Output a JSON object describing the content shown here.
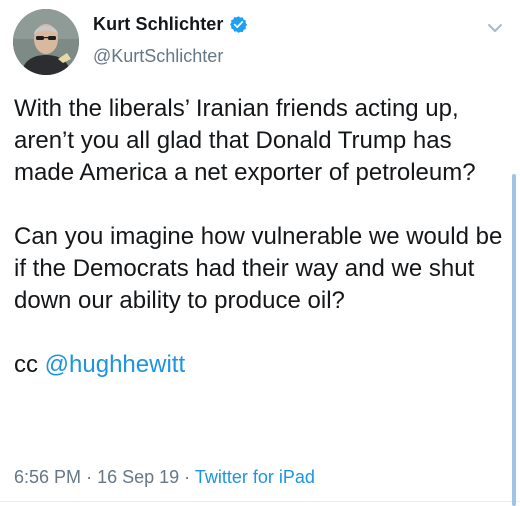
{
  "author": {
    "display_name": "Kurt Schlichter",
    "handle": "@KurtSchlichter",
    "verified": true,
    "avatar_icon": "profile-photo"
  },
  "tweet": {
    "paragraphs": [
      "With the liberals’ Iranian friends acting up, aren’t you all glad that Donald Trump has made America a net exporter of petroleum?",
      "Can you imagine how vulnerable we would be if the Democrats had their way and we shut down our ability to produce oil?"
    ],
    "cc_prefix": "cc",
    "mention": "@hughhewitt"
  },
  "meta": {
    "time": "6:56 PM",
    "separator": "·",
    "date": "16 Sep 19",
    "source": "Twitter for iPad"
  },
  "icons": {
    "verified": "verified-badge-icon",
    "menu": "chevron-down-icon"
  },
  "colors": {
    "link": "#1b95e0",
    "text": "#14171a",
    "secondary": "#657786",
    "verified": "#1da1f2"
  }
}
